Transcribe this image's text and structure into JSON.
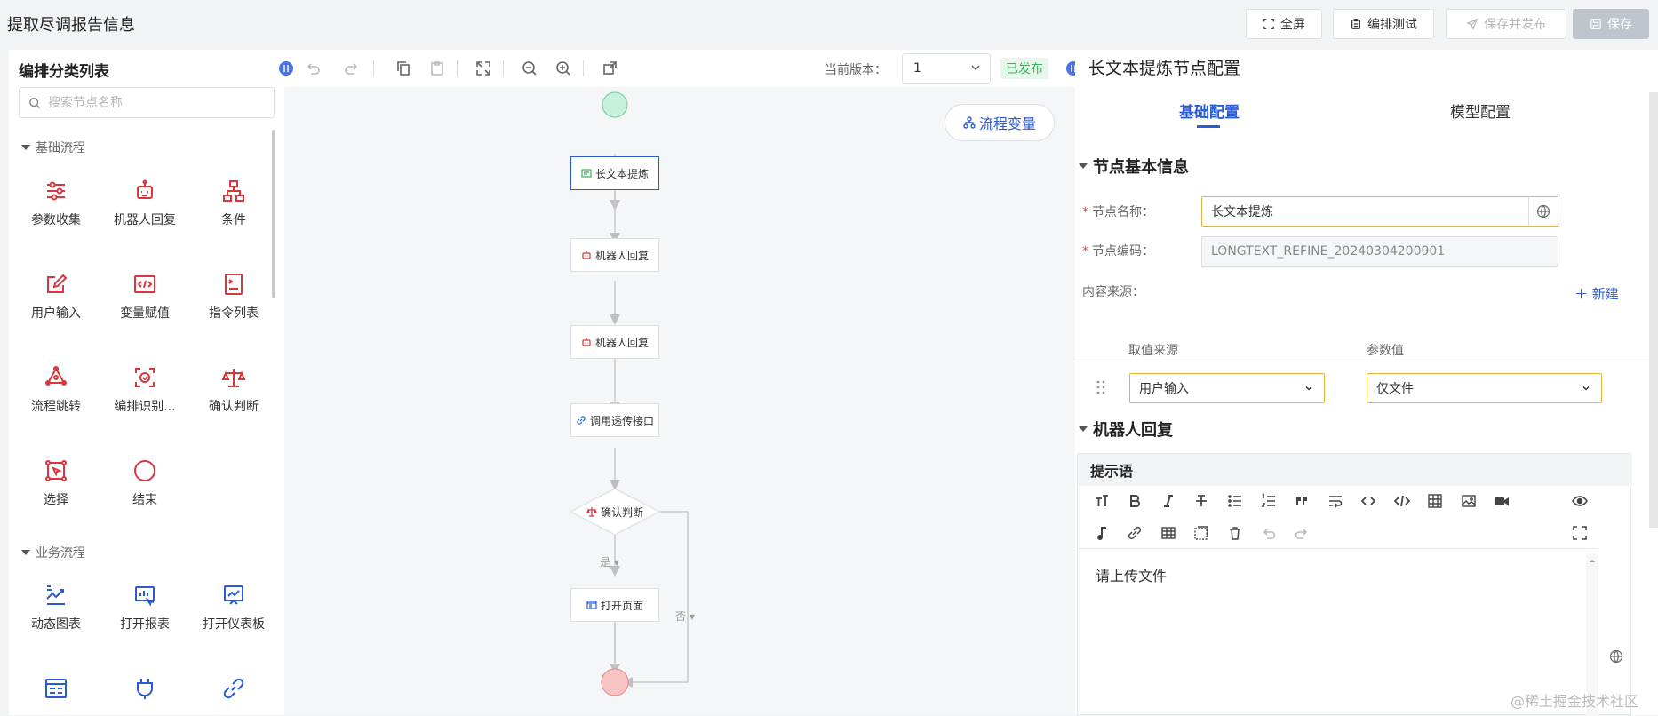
{
  "app": {
    "title": "提取尽调报告信息"
  },
  "top_actions": {
    "fullscreen": "全屏",
    "test": "编排测试",
    "save_publish": "保存并发布",
    "save": "保存"
  },
  "left_panel": {
    "title": "编排分类列表",
    "search_placeholder": "搜索节点名称",
    "sections": [
      {
        "label": "基础流程",
        "items": [
          "参数收集",
          "机器人回复",
          "条件",
          "用户输入",
          "变量赋值",
          "指令列表",
          "流程跳转",
          "编排识别...",
          "确认判断",
          "选择",
          "结束"
        ]
      },
      {
        "label": "业务流程",
        "items": [
          "动态图表",
          "打开报表",
          "打开仪表板"
        ]
      }
    ]
  },
  "toolbar": {
    "version_label": "当前版本：",
    "version_value": "1",
    "status": "已发布"
  },
  "canvas": {
    "flow_variables_button": "流程变量",
    "nodes": [
      "长文本提炼",
      "机器人回复",
      "机器人回复",
      "调用透传接口",
      "确认判断",
      "打开页面"
    ],
    "edge_yes": "是",
    "edge_no": "否"
  },
  "right_panel": {
    "title": "长文本提炼节点配置",
    "tabs": [
      "基础配置",
      "模型配置"
    ],
    "group_basic": "节点基本信息",
    "name_label": "节点名称：",
    "name_value": "长文本提炼",
    "code_label": "节点编码：",
    "code_value": "LONGTEXT_REFINE_20240304200901",
    "source_label": "内容来源：",
    "add_new": "新建",
    "col_source": "取值来源",
    "col_param": "参数值",
    "source_value": "用户输入",
    "param_value": "仅文件",
    "group_robot": "机器人回复",
    "prompt_title": "提示语",
    "prompt_content": "请上传文件"
  },
  "watermark": "@稀土掘金技术社区",
  "colors": {
    "accent": "#2a5bd7",
    "danger_icon": "#d9363e",
    "business_icon": "#2a5bd7",
    "published": "#3cae5f",
    "focus_border": "#e8b33a"
  }
}
